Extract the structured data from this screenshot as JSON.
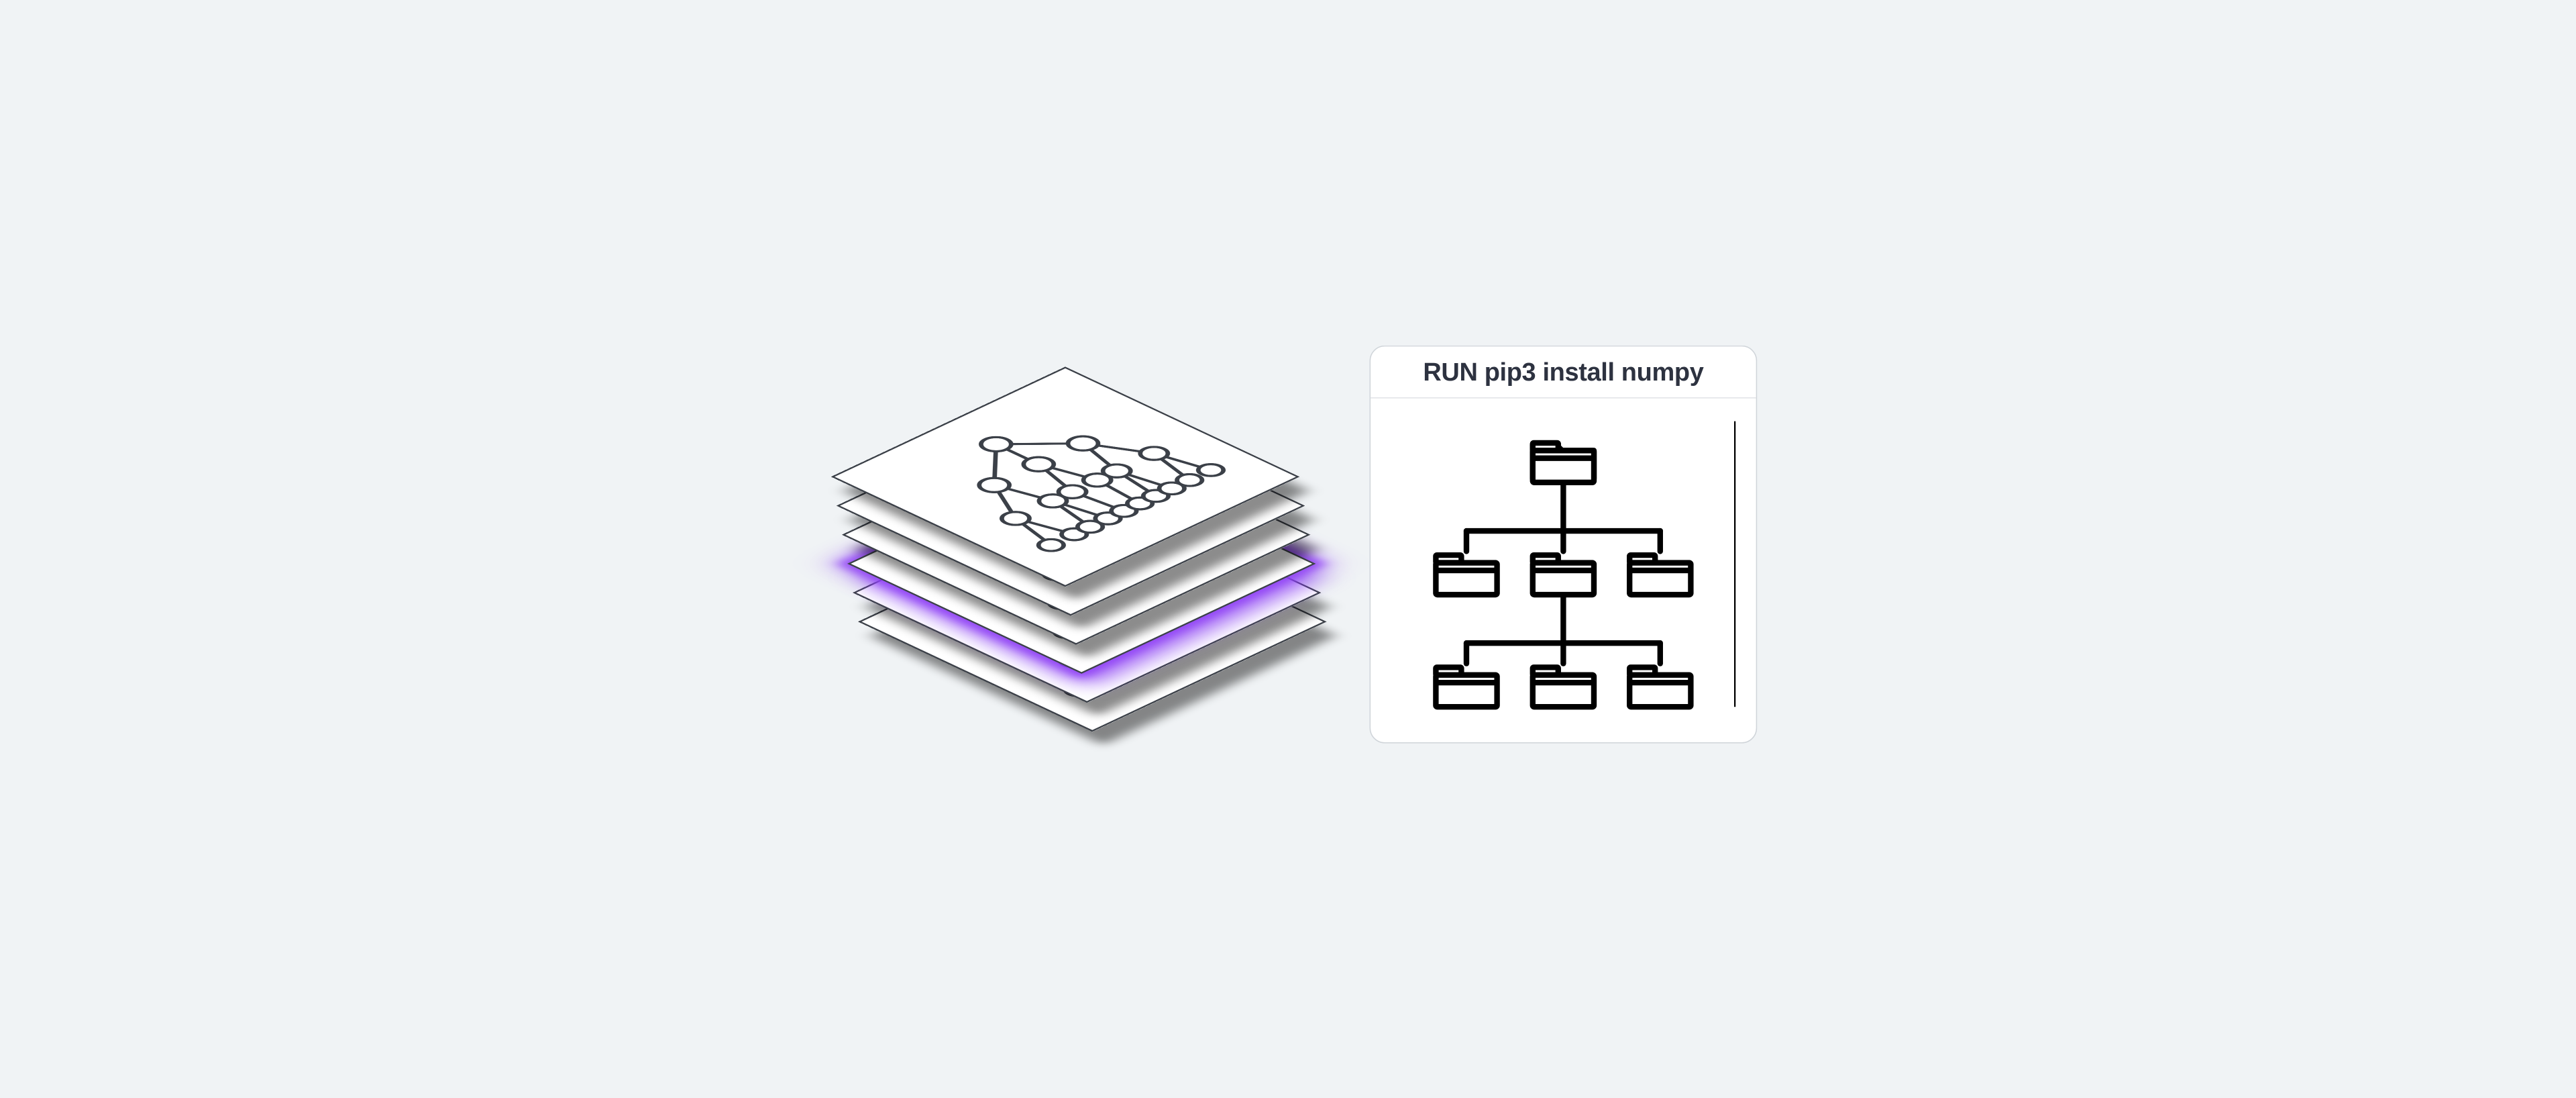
{
  "diagram": {
    "title": "RUN pip3 install numpy",
    "left_stack": {
      "description": "isometric stack of image layers",
      "layer_count": 6,
      "highlighted_layer_index": 3,
      "highlight_color": "#8f41f5",
      "layer_border_color": "#3b4048",
      "layer_fill": "#ffffff",
      "layer_content": "file-tree graph of circular nodes connected by lines"
    },
    "right_panel": {
      "header_text": "RUN pip3 install numpy",
      "border_color": "#cfd4d9",
      "background": "#ffffff",
      "tree": {
        "levels": 3,
        "nodes_per_level": [
          1,
          3,
          3
        ],
        "node_icon": "folder",
        "stroke": "#000000"
      },
      "has_right_scrollbar_line": true
    },
    "canvas_background": "#f0f3f5"
  }
}
